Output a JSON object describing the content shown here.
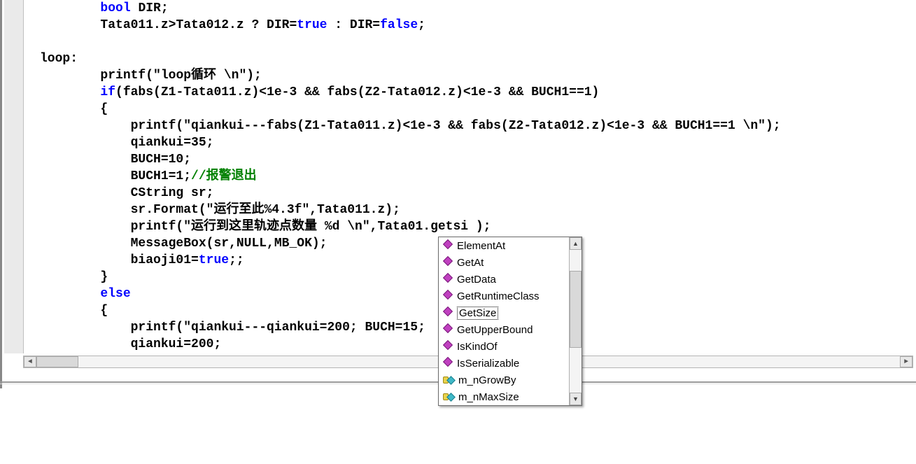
{
  "code": {
    "lines": [
      {
        "ind": 2,
        "segs": [
          {
            "t": "bool",
            "c": "kw"
          },
          {
            "t": " DIR;",
            "c": ""
          }
        ]
      },
      {
        "ind": 2,
        "segs": [
          {
            "t": "Tata011.z>Tata012.z ? DIR=",
            "c": ""
          },
          {
            "t": "true",
            "c": "kw"
          },
          {
            "t": " : DIR=",
            "c": ""
          },
          {
            "t": "false",
            "c": "kw"
          },
          {
            "t": ";",
            "c": ""
          }
        ]
      },
      {
        "ind": 0,
        "segs": []
      },
      {
        "ind": 0,
        "segs": [
          {
            "t": "loop:",
            "c": ""
          }
        ]
      },
      {
        "ind": 2,
        "segs": [
          {
            "t": "printf(\"loop循环 \\n\");",
            "c": ""
          }
        ]
      },
      {
        "ind": 2,
        "segs": [
          {
            "t": "if",
            "c": "kw"
          },
          {
            "t": "(fabs(Z1-Tata011.z)<1e-3 && fabs(Z2-Tata012.z)<1e-3 && BUCH1==1)",
            "c": ""
          }
        ]
      },
      {
        "ind": 2,
        "segs": [
          {
            "t": "{",
            "c": ""
          }
        ]
      },
      {
        "ind": 3,
        "segs": [
          {
            "t": "printf(\"qiankui---fabs(Z1-Tata011.z)<1e-3 && fabs(Z2-Tata012.z)<1e-3 && BUCH1==1 \\n\");",
            "c": ""
          }
        ]
      },
      {
        "ind": 3,
        "segs": [
          {
            "t": "qiankui=35;",
            "c": ""
          }
        ]
      },
      {
        "ind": 3,
        "segs": [
          {
            "t": "BUCH=10;",
            "c": ""
          }
        ]
      },
      {
        "ind": 3,
        "segs": [
          {
            "t": "BUCH1=1;",
            "c": ""
          },
          {
            "t": "//报警退出",
            "c": "cm"
          }
        ]
      },
      {
        "ind": 3,
        "segs": [
          {
            "t": "CString sr;",
            "c": ""
          }
        ]
      },
      {
        "ind": 3,
        "segs": [
          {
            "t": "sr.Format(\"运行至此%4.3f\",Tata011.z);",
            "c": ""
          }
        ]
      },
      {
        "ind": 3,
        "segs": [
          {
            "t": "printf(\"运行到这里轨迹点数量 %d \\n\",Tata01.getsi );",
            "c": ""
          }
        ]
      },
      {
        "ind": 3,
        "segs": [
          {
            "t": "MessageBox(sr,NULL,MB_OK);",
            "c": ""
          }
        ]
      },
      {
        "ind": 3,
        "segs": [
          {
            "t": "biaoji01=",
            "c": ""
          },
          {
            "t": "true",
            "c": "kw"
          },
          {
            "t": ";;",
            "c": ""
          }
        ]
      },
      {
        "ind": 2,
        "segs": [
          {
            "t": "}",
            "c": ""
          }
        ]
      },
      {
        "ind": 2,
        "segs": [
          {
            "t": "else",
            "c": "kw"
          }
        ]
      },
      {
        "ind": 2,
        "segs": [
          {
            "t": "{",
            "c": ""
          }
        ]
      },
      {
        "ind": 3,
        "segs": [
          {
            "t": "printf(\"qiankui---qiankui=200; BUCH=15;",
            "c": ""
          }
        ]
      },
      {
        "ind": 3,
        "segs": [
          {
            "t": "qiankui=200;",
            "c": ""
          }
        ]
      }
    ]
  },
  "autocomplete": {
    "items": [
      {
        "label": "ElementAt",
        "kind": "method",
        "selected": false
      },
      {
        "label": "GetAt",
        "kind": "method",
        "selected": false
      },
      {
        "label": "GetData",
        "kind": "method",
        "selected": false
      },
      {
        "label": "GetRuntimeClass",
        "kind": "method",
        "selected": false
      },
      {
        "label": "GetSize",
        "kind": "method",
        "selected": true
      },
      {
        "label": "GetUpperBound",
        "kind": "method",
        "selected": false
      },
      {
        "label": "IsKindOf",
        "kind": "method",
        "selected": false
      },
      {
        "label": "IsSerializable",
        "kind": "method",
        "selected": false
      },
      {
        "label": "m_nGrowBy",
        "kind": "var",
        "selected": false
      },
      {
        "label": "m_nMaxSize",
        "kind": "var",
        "selected": false
      }
    ]
  },
  "scroll": {
    "hleft": "◄",
    "hright": "►",
    "vup": "▲",
    "vdown": "▼"
  }
}
